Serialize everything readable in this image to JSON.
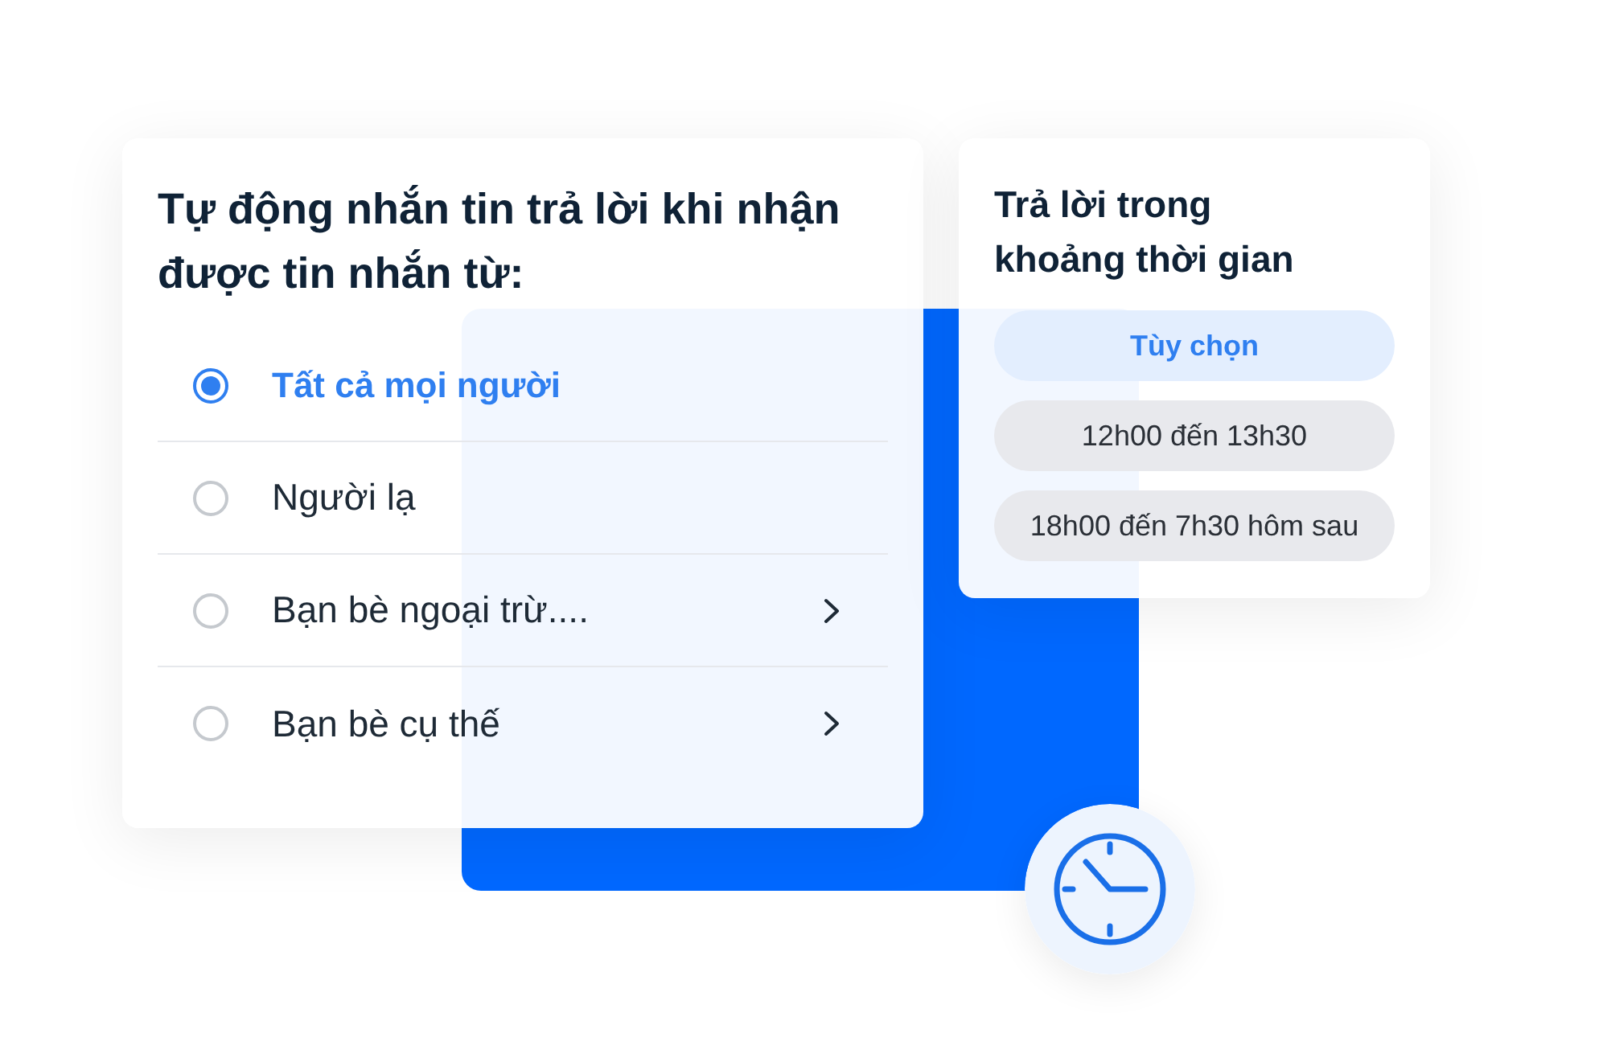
{
  "left_card": {
    "title": "Tự động nhắn tin trả lời khi nhận được tin nhắn từ:",
    "options": [
      {
        "label": "Tất cả mọi người",
        "selected": true,
        "has_submenu": false
      },
      {
        "label": "Người lạ",
        "selected": false,
        "has_submenu": false
      },
      {
        "label": "Bạn bè ngoại trừ....",
        "selected": false,
        "has_submenu": true
      },
      {
        "label": "Bạn bè cụ thế",
        "selected": false,
        "has_submenu": true
      }
    ]
  },
  "right_card": {
    "title": "Trả lời trong khoảng thời gian",
    "options": [
      {
        "label": "Tùy chọn",
        "selected": true
      },
      {
        "label": "12h00 đến 13h30",
        "selected": false
      },
      {
        "label": "18h00 đến 7h30 hôm sau",
        "selected": false
      }
    ]
  }
}
